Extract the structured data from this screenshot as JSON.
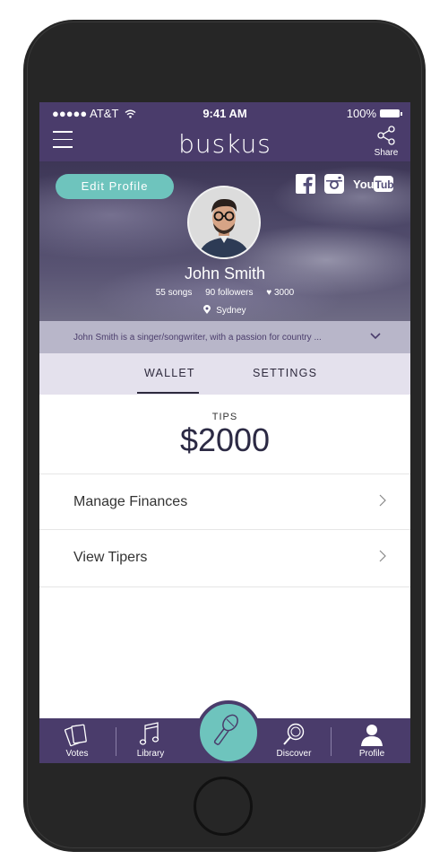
{
  "status": {
    "carrier": "●●●●● AT&T",
    "time": "9:41 AM",
    "battery": "100%"
  },
  "nav": {
    "logo": "buskus",
    "share_label": "Share"
  },
  "profile": {
    "edit_label": "Edit Profile",
    "name": "John Smith",
    "songs": "55 songs",
    "followers": "90 followers",
    "likes": "♥ 3000",
    "location": "Sydney",
    "bio": "John Smith is a singer/songwriter, with a passion for country ...",
    "socials": [
      "facebook-icon",
      "instagram-icon",
      "youtube-icon"
    ],
    "youtube_text": "YouTube"
  },
  "tabs": {
    "wallet": "WALLET",
    "settings": "SETTINGS",
    "active": "wallet"
  },
  "wallet": {
    "tips_label": "TIPS",
    "tips_amount": "$2000",
    "rows": [
      {
        "label": "Manage Finances"
      },
      {
        "label": "View Tipers"
      }
    ]
  },
  "tabbar": {
    "votes": "Votes",
    "library": "Library",
    "discover": "Discover",
    "profile": "Profile"
  },
  "colors": {
    "brand": "#4a3c6b",
    "accent": "#6ec4bd",
    "tab_bg": "#e4e1ed"
  }
}
